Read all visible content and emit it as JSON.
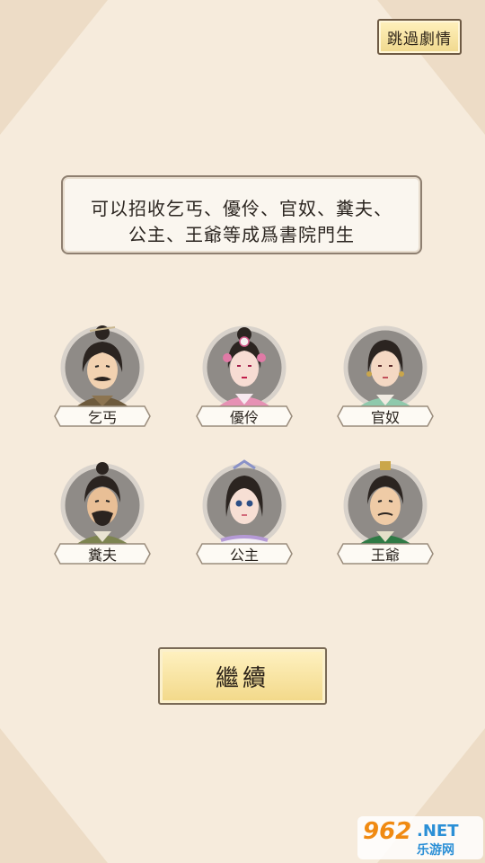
{
  "header": {
    "skip_label": "跳過劇情"
  },
  "intro": {
    "line1": "可以招收乞丐、優伶、官奴、糞夫、",
    "line2": "公主、王爺等成爲書院門生"
  },
  "characters": [
    {
      "label": "乞丐"
    },
    {
      "label": "優伶"
    },
    {
      "label": "官奴"
    },
    {
      "label": "糞夫"
    },
    {
      "label": "公主"
    },
    {
      "label": "王爺"
    }
  ],
  "footer": {
    "continue_label": "繼續"
  },
  "watermark": {
    "number": "962",
    "suffix": ".NET",
    "site_cn": "乐游网"
  },
  "colors": {
    "background": "#f3e6d4",
    "button_gold": "#f2d888",
    "border_brown": "#6e5a44",
    "portrait_circle": "#8f8b87"
  }
}
